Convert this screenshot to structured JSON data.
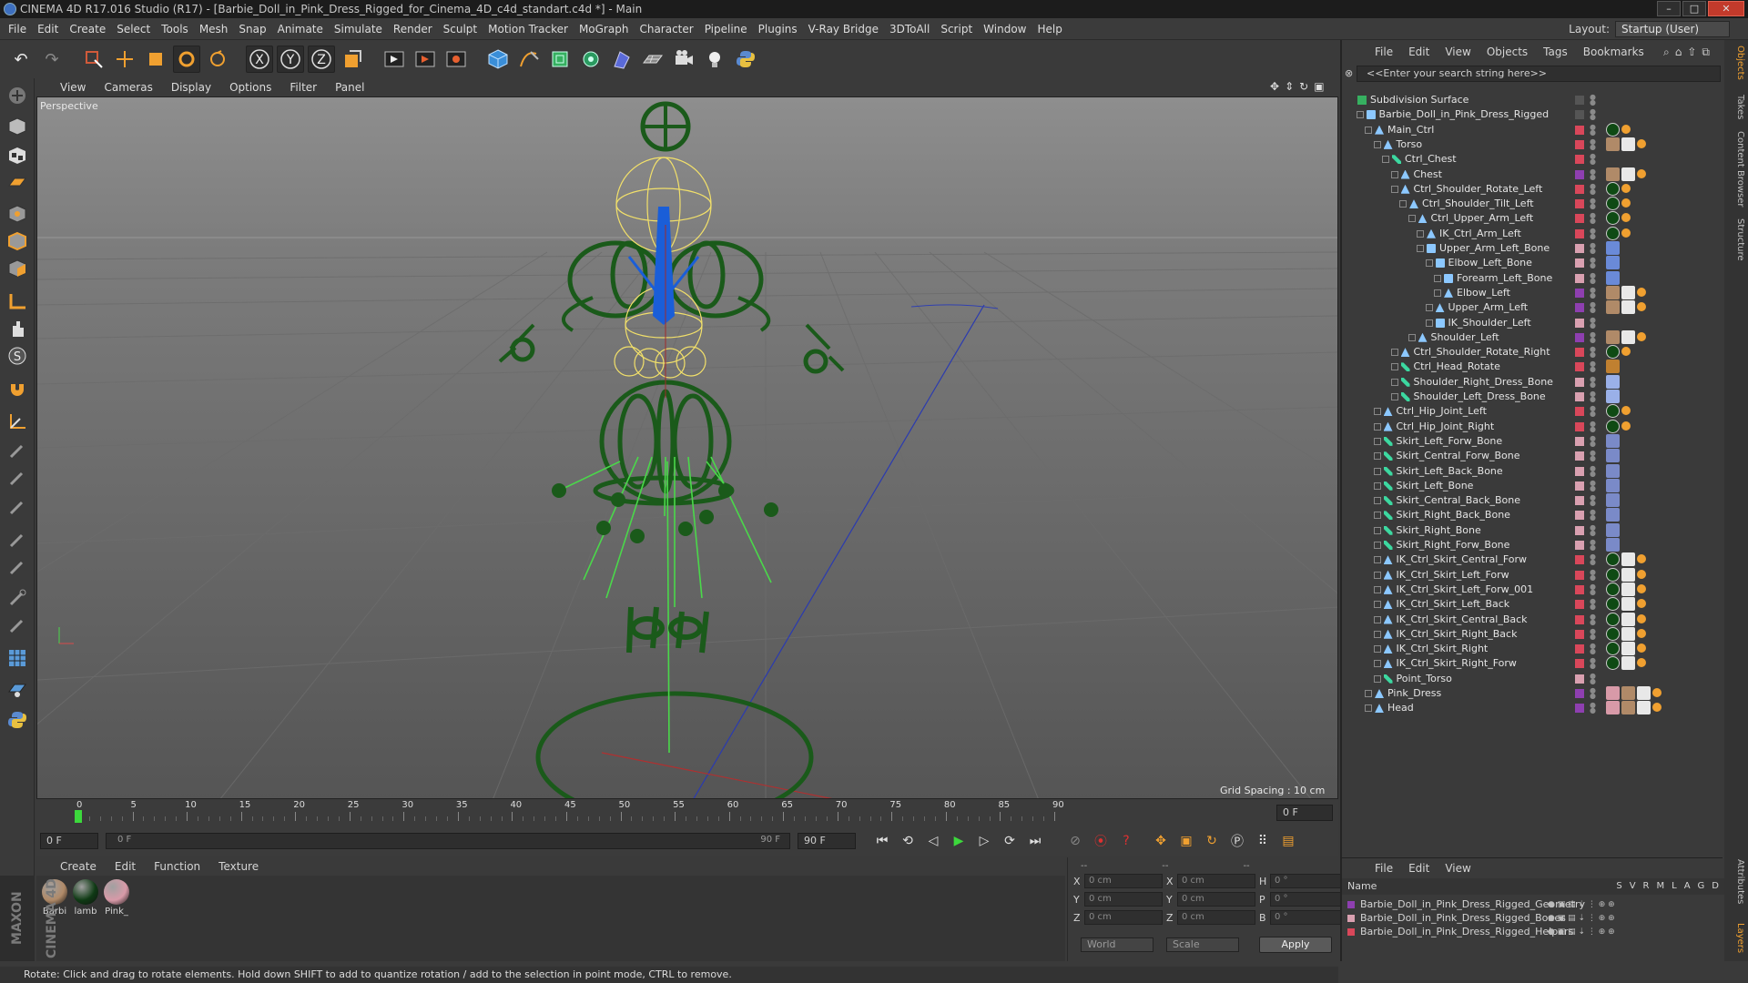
{
  "window": {
    "title": "CINEMA 4D R17.016 Studio (R17) - [Barbie_Doll_in_Pink_Dress_Rigged_for_Cinema_4D_c4d_standart.c4d *] - Main"
  },
  "menu": [
    "File",
    "Edit",
    "Create",
    "Select",
    "Tools",
    "Mesh",
    "Snap",
    "Animate",
    "Simulate",
    "Render",
    "Sculpt",
    "Motion Tracker",
    "MoGraph",
    "Character",
    "Pipeline",
    "Plugins",
    "V-Ray Bridge",
    "3DToAll",
    "Script",
    "Window",
    "Help"
  ],
  "layout": {
    "label": "Layout:",
    "value": "Startup (User)"
  },
  "toolbar_axes": [
    "X",
    "Y",
    "Z"
  ],
  "viewport": {
    "menu": [
      "View",
      "Cameras",
      "Display",
      "Options",
      "Filter",
      "Panel"
    ],
    "label": "Perspective",
    "grid_spacing": "Grid Spacing : 10 cm"
  },
  "timeline": {
    "ticks": [
      "0",
      "5",
      "10",
      "15",
      "20",
      "25",
      "30",
      "35",
      "40",
      "45",
      "50",
      "55",
      "60",
      "65",
      "70",
      "75",
      "80",
      "85",
      "90"
    ],
    "current_frame": "0 F",
    "start_field": "0 F",
    "slider_left": "0 F",
    "slider_right": "90 F",
    "end_field": "90 F"
  },
  "materials": {
    "menu": [
      "Create",
      "Edit",
      "Function",
      "Texture"
    ],
    "items": [
      {
        "name": "Barbi",
        "color": "#b08a68"
      },
      {
        "name": "lamb",
        "color": "#0f3a14"
      },
      {
        "name": "Pink_",
        "color": "#d89aa8"
      }
    ]
  },
  "coords": {
    "headers": [
      "--",
      "--",
      "--"
    ],
    "rows": [
      {
        "a": "X",
        "av": "0 cm",
        "b": "X",
        "bv": "0 cm",
        "c": "H",
        "cv": "0 °"
      },
      {
        "a": "Y",
        "av": "0 cm",
        "b": "Y",
        "bv": "0 cm",
        "c": "P",
        "cv": "0 °"
      },
      {
        "a": "Z",
        "av": "0 cm",
        "b": "Z",
        "bv": "0 cm",
        "c": "B",
        "cv": "0 °"
      }
    ],
    "mode": "World",
    "transform": "Scale",
    "apply": "Apply"
  },
  "status": "Rotate: Click and drag to rotate elements. Hold down SHIFT to add to quantize rotation / add to the selection in point mode, CTRL to remove.",
  "object_manager": {
    "menu": [
      "File",
      "Edit",
      "View",
      "Objects",
      "Tags",
      "Bookmarks"
    ],
    "search_placeholder": "<<Enter your search string here>>",
    "rows": [
      {
        "name": "Subdivision Surface",
        "depth": 0,
        "type": "subd",
        "layer": "",
        "tags": []
      },
      {
        "name": "Barbie_Doll_in_Pink_Dress_Rigged",
        "depth": 1,
        "type": "null",
        "layer": "",
        "tags": []
      },
      {
        "name": "Main_Ctrl",
        "depth": 2,
        "type": "joint",
        "layer": "#d9475a",
        "tags": [
          "g",
          "o"
        ]
      },
      {
        "name": "Torso",
        "depth": 3,
        "type": "joint",
        "layer": "#d9475a",
        "tags": [
          "s",
          "c",
          "o"
        ]
      },
      {
        "name": "Ctrl_Chest",
        "depth": 4,
        "type": "bone",
        "layer": "#d9475a",
        "tags": []
      },
      {
        "name": "Chest",
        "depth": 5,
        "type": "joint",
        "layer": "#8e3fb0",
        "tags": [
          "s",
          "c",
          "o"
        ]
      },
      {
        "name": "Ctrl_Shoulder_Rotate_Left",
        "depth": 5,
        "type": "joint",
        "layer": "#d9475a",
        "tags": [
          "g",
          "o"
        ]
      },
      {
        "name": "Ctrl_Shoulder_Tilt_Left",
        "depth": 6,
        "type": "joint",
        "layer": "#d9475a",
        "tags": [
          "g",
          "o"
        ]
      },
      {
        "name": "Ctrl_Upper_Arm_Left",
        "depth": 7,
        "type": "joint",
        "layer": "#d9475a",
        "tags": [
          "g",
          "o"
        ]
      },
      {
        "name": "IK_Ctrl_Arm_Left",
        "depth": 8,
        "type": "joint",
        "layer": "#d9475a",
        "tags": [
          "g",
          "o"
        ]
      },
      {
        "name": "Upper_Arm_Left_Bone",
        "depth": 8,
        "type": "null",
        "layer": "#d9a0b0",
        "tags": [
          "k"
        ]
      },
      {
        "name": "Elbow_Left_Bone",
        "depth": 9,
        "type": "null",
        "layer": "#d9a0b0",
        "tags": [
          "k"
        ]
      },
      {
        "name": "Forearm_Left_Bone",
        "depth": 10,
        "type": "null",
        "layer": "#d9a0b0",
        "tags": [
          "k"
        ]
      },
      {
        "name": "Elbow_Left",
        "depth": 10,
        "type": "joint",
        "layer": "#8e3fb0",
        "tags": [
          "s",
          "c",
          "o"
        ]
      },
      {
        "name": "Upper_Arm_Left",
        "depth": 9,
        "type": "joint",
        "layer": "#8e3fb0",
        "tags": [
          "s",
          "c",
          "o"
        ]
      },
      {
        "name": "IK_Shoulder_Left",
        "depth": 9,
        "type": "null",
        "layer": "#d9a0b0",
        "tags": []
      },
      {
        "name": "Shoulder_Left",
        "depth": 7,
        "type": "joint",
        "layer": "#8e3fb0",
        "tags": [
          "s",
          "c",
          "o"
        ]
      },
      {
        "name": "Ctrl_Shoulder_Rotate_Right",
        "depth": 5,
        "type": "joint",
        "layer": "#d9475a",
        "tags": [
          "g",
          "o"
        ]
      },
      {
        "name": "Ctrl_Head_Rotate",
        "depth": 5,
        "type": "bone",
        "layer": "#d9475a",
        "tags": [
          "n"
        ]
      },
      {
        "name": "Shoulder_Right_Dress_Bone",
        "depth": 5,
        "type": "bone",
        "layer": "#d9a0b0",
        "tags": [
          "w"
        ]
      },
      {
        "name": "Shoulder_Left_Dress_Bone",
        "depth": 5,
        "type": "bone",
        "layer": "#d9a0b0",
        "tags": [
          "w"
        ]
      },
      {
        "name": "Ctrl_Hip_Joint_Left",
        "depth": 3,
        "type": "joint",
        "layer": "#d9475a",
        "tags": [
          "g",
          "o"
        ]
      },
      {
        "name": "Ctrl_Hip_Joint_Right",
        "depth": 3,
        "type": "joint",
        "layer": "#d9475a",
        "tags": [
          "g",
          "o"
        ]
      },
      {
        "name": "Skirt_Left_Forw_Bone",
        "depth": 3,
        "type": "bone",
        "layer": "#d9a0b0",
        "tags": [
          "p"
        ]
      },
      {
        "name": "Skirt_Central_Forw_Bone",
        "depth": 3,
        "type": "bone",
        "layer": "#d9a0b0",
        "tags": [
          "p"
        ]
      },
      {
        "name": "Skirt_Left_Back_Bone",
        "depth": 3,
        "type": "bone",
        "layer": "#d9a0b0",
        "tags": [
          "p"
        ]
      },
      {
        "name": "Skirt_Left_Bone",
        "depth": 3,
        "type": "bone",
        "layer": "#d9a0b0",
        "tags": [
          "p"
        ]
      },
      {
        "name": "Skirt_Central_Back_Bone",
        "depth": 3,
        "type": "bone",
        "layer": "#d9a0b0",
        "tags": [
          "p"
        ]
      },
      {
        "name": "Skirt_Right_Back_Bone",
        "depth": 3,
        "type": "bone",
        "layer": "#d9a0b0",
        "tags": [
          "p"
        ]
      },
      {
        "name": "Skirt_Right_Bone",
        "depth": 3,
        "type": "bone",
        "layer": "#d9a0b0",
        "tags": [
          "p"
        ]
      },
      {
        "name": "Skirt_Right_Forw_Bone",
        "depth": 3,
        "type": "bone",
        "layer": "#d9a0b0",
        "tags": [
          "p"
        ]
      },
      {
        "name": "IK_Ctrl_Skirt_Central_Forw",
        "depth": 3,
        "type": "joint",
        "layer": "#d9475a",
        "tags": [
          "g",
          "c",
          "o"
        ]
      },
      {
        "name": "IK_Ctrl_Skirt_Left_Forw",
        "depth": 3,
        "type": "joint",
        "layer": "#d9475a",
        "tags": [
          "g",
          "c",
          "o"
        ]
      },
      {
        "name": "IK_Ctrl_Skirt_Left_Forw_001",
        "depth": 3,
        "type": "joint",
        "layer": "#d9475a",
        "tags": [
          "g",
          "c",
          "o"
        ]
      },
      {
        "name": "IK_Ctrl_Skirt_Left_Back",
        "depth": 3,
        "type": "joint",
        "layer": "#d9475a",
        "tags": [
          "g",
          "c",
          "o"
        ]
      },
      {
        "name": "IK_Ctrl_Skirt_Central_Back",
        "depth": 3,
        "type": "joint",
        "layer": "#d9475a",
        "tags": [
          "g",
          "c",
          "o"
        ]
      },
      {
        "name": "IK_Ctrl_Skirt_Right_Back",
        "depth": 3,
        "type": "joint",
        "layer": "#d9475a",
        "tags": [
          "g",
          "c",
          "o"
        ]
      },
      {
        "name": "IK_Ctrl_Skirt_Right",
        "depth": 3,
        "type": "joint",
        "layer": "#d9475a",
        "tags": [
          "g",
          "c",
          "o"
        ]
      },
      {
        "name": "IK_Ctrl_Skirt_Right_Forw",
        "depth": 3,
        "type": "joint",
        "layer": "#d9475a",
        "tags": [
          "g",
          "c",
          "o"
        ]
      },
      {
        "name": "Point_Torso",
        "depth": 3,
        "type": "bone",
        "layer": "#d9a0b0",
        "tags": []
      },
      {
        "name": "Pink_Dress",
        "depth": 2,
        "type": "joint",
        "layer": "#8e3fb0",
        "tags": [
          "m",
          "s",
          "c",
          "o"
        ]
      },
      {
        "name": "Head",
        "depth": 2,
        "type": "joint",
        "layer": "#8e3fb0",
        "tags": [
          "m",
          "s",
          "c",
          "o"
        ]
      }
    ]
  },
  "layer_manager": {
    "menu": [
      "File",
      "Edit",
      "View"
    ],
    "header_name": "Name",
    "cols": [
      "S",
      "V",
      "R",
      "M",
      "L",
      "A",
      "G",
      "D"
    ],
    "layers": [
      {
        "name": "Barbie_Doll_in_Pink_Dress_Rigged_Geometry",
        "color": "#8e3fb0"
      },
      {
        "name": "Barbie_Doll_in_Pink_Dress_Rigged_Bones",
        "color": "#d9a0b0"
      },
      {
        "name": "Barbie_Doll_in_Pink_Dress_Rigged_Helpers",
        "color": "#d9475a"
      }
    ]
  },
  "side_tabs": [
    "Objects",
    "Takes",
    "Content Browser",
    "Structure",
    "Attributes",
    "Layers"
  ]
}
